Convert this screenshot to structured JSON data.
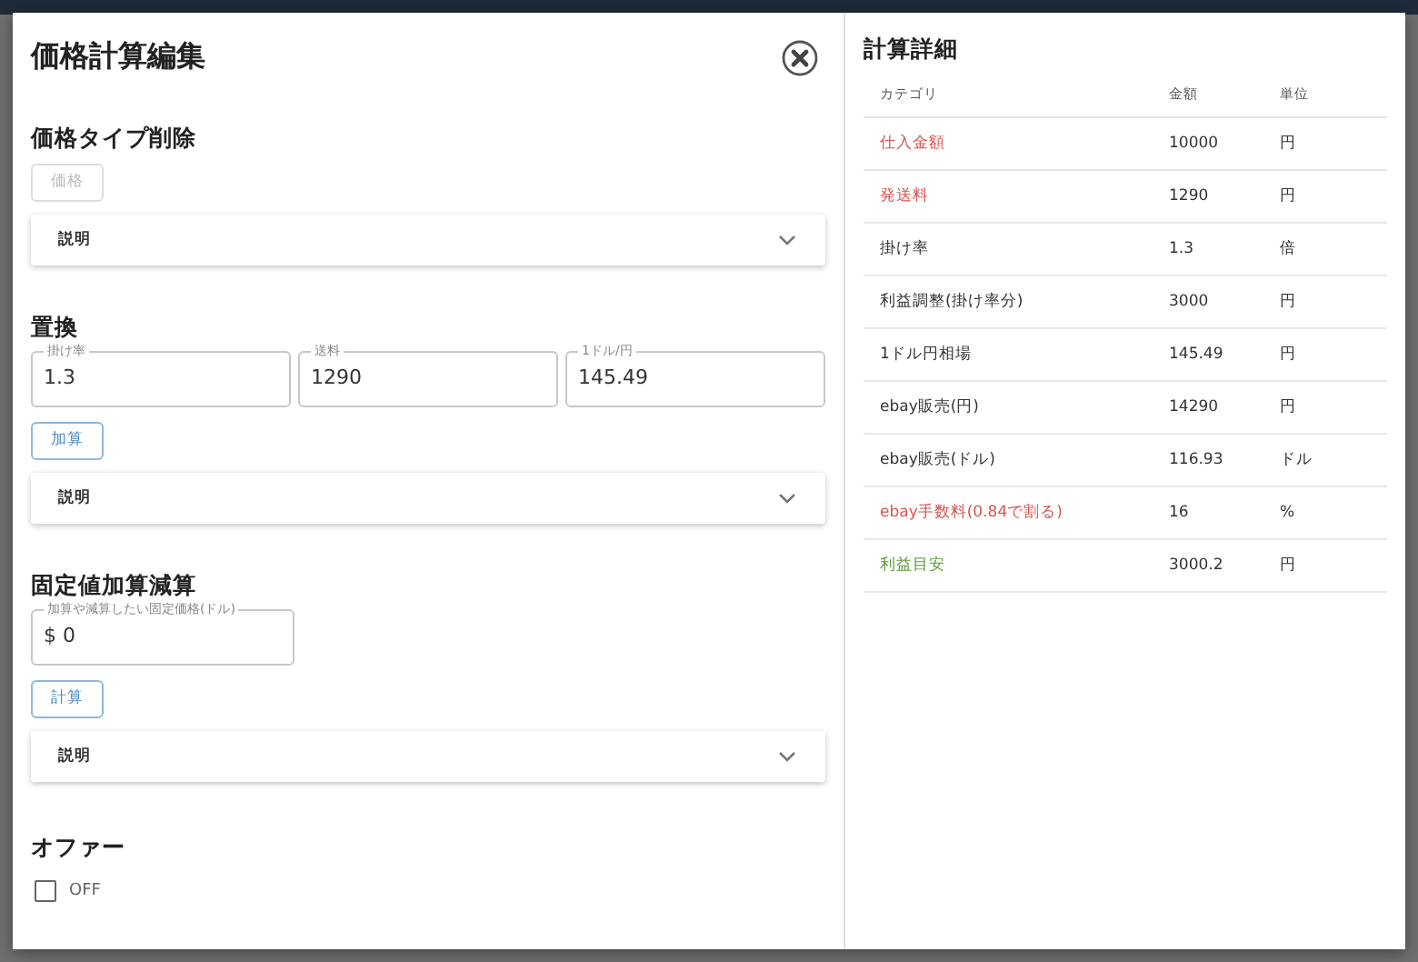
{
  "dialog": {
    "title": "価格計算編集"
  },
  "sections": [
    {
      "heading": "価格タイプ削除",
      "button": {
        "label": "価格",
        "disabled": true
      },
      "accordion": {
        "label": "説明",
        "expanded": false
      }
    },
    {
      "heading": "置換",
      "fields": [
        {
          "label": "掛け率",
          "value": "1.3"
        },
        {
          "label": "送料",
          "value": "1290"
        },
        {
          "label": "1ドル/円",
          "value": "145.49"
        }
      ],
      "button": {
        "label": "加算",
        "disabled": false
      },
      "accordion": {
        "label": "説明",
        "expanded": false
      }
    },
    {
      "heading": "固定値加算減算",
      "fields": [
        {
          "label": "加算や減算したい固定価格(ドル)",
          "value": "$ 0"
        }
      ],
      "button": {
        "label": "計算",
        "disabled": false
      },
      "accordion": {
        "label": "説明",
        "expanded": false
      }
    }
  ],
  "offer": {
    "heading": "オファー",
    "checkbox": {
      "label": "OFF",
      "checked": false
    }
  },
  "details": {
    "title": "計算詳細",
    "columns": [
      "カテゴリ",
      "金額",
      "単位"
    ],
    "rows": [
      {
        "category": "仕入金額",
        "amount": "10000",
        "unit": "円",
        "color": "#d9534f"
      },
      {
        "category": "発送料",
        "amount": "1290",
        "unit": "円",
        "color": "#d9534f"
      },
      {
        "category": "掛け率",
        "amount": "1.3",
        "unit": "倍",
        "color": "#333333"
      },
      {
        "category": "利益調整(掛け率分)",
        "amount": "3000",
        "unit": "円",
        "color": "#333333"
      },
      {
        "category": "1ドル円相場",
        "amount": "145.49",
        "unit": "円",
        "color": "#333333"
      },
      {
        "category": "ebay販売(円)",
        "amount": "14290",
        "unit": "円",
        "color": "#333333"
      },
      {
        "category": "ebay販売(ドル)",
        "amount": "116.93",
        "unit": "ドル",
        "color": "#333333"
      },
      {
        "category": "ebay手数料(0.84で割る)",
        "amount": "16",
        "unit": "%",
        "color": "#d9534f"
      },
      {
        "category": "利益目安",
        "amount": "3000.2",
        "unit": "円",
        "color": "#5a9a3c"
      }
    ]
  }
}
